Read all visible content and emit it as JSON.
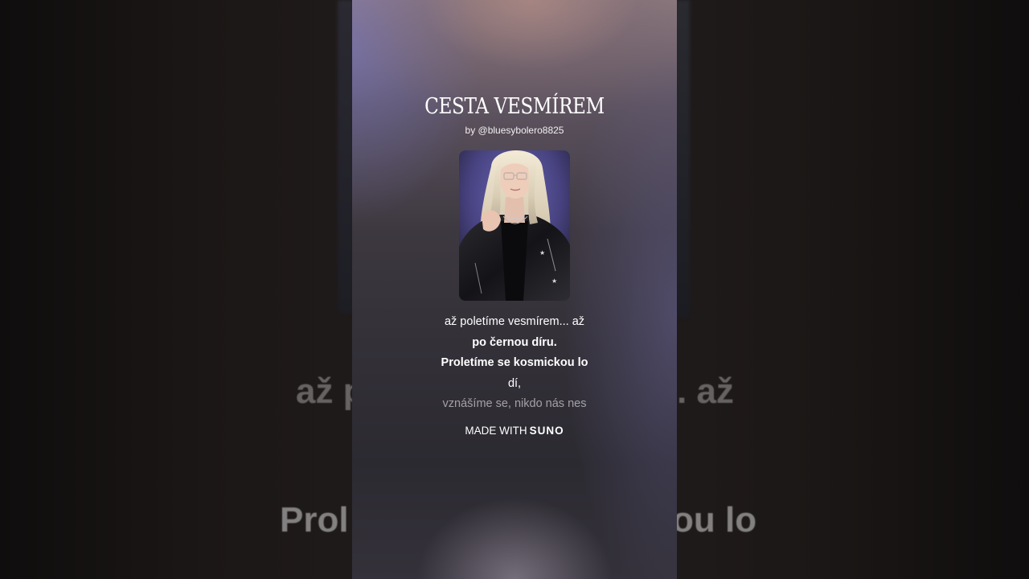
{
  "song": {
    "title": "CESTA VESMÍREM",
    "byline": "by @bluesybolero8825"
  },
  "lyrics": [
    {
      "text": "až poletíme vesmírem... až",
      "state": "past"
    },
    {
      "text": "po černou díru.",
      "state": "active"
    },
    {
      "text": "Proletíme se kosmickou lo",
      "state": "active"
    },
    {
      "text": "dí,",
      "state": "next"
    },
    {
      "text": "vznášíme se, nikdo nás nes",
      "state": "dim"
    }
  ],
  "footer": {
    "made_with": "MADE WITH",
    "brand": "SUNO"
  },
  "background": {
    "line1_left": "až p",
    "line1_right": ". až",
    "line2_left": "Prol",
    "line2_right": "ou lo"
  },
  "colors": {
    "text": "#ffffff",
    "panel_top": "#8d7a80",
    "panel_bottom": "#2c2a31",
    "backdrop": "#0e0c0c"
  },
  "icons": {
    "cover_art": "artist-portrait-image"
  }
}
